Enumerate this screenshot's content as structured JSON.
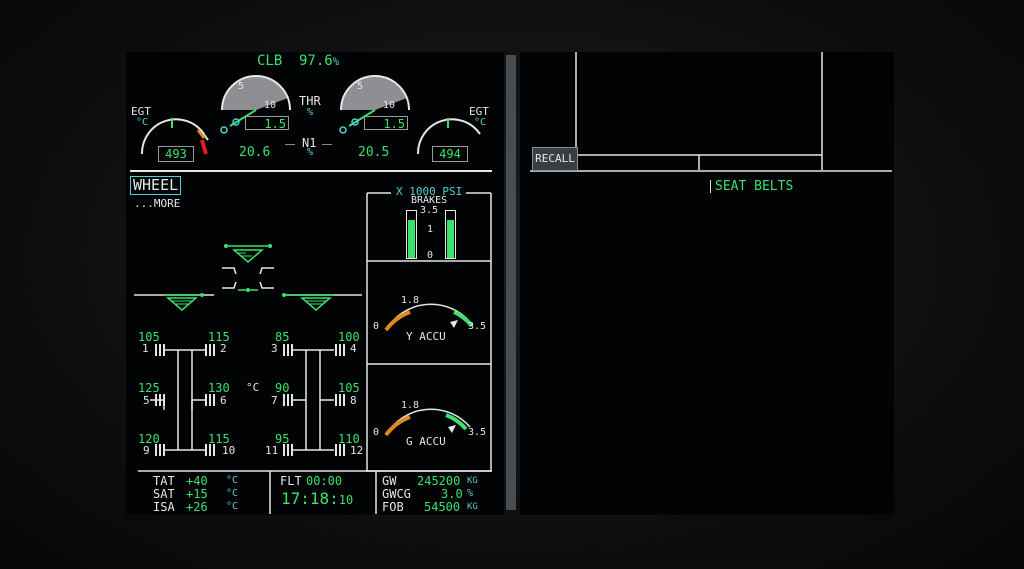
{
  "engine": {
    "mode": "CLB",
    "limit": "97.6",
    "limit_unit": "%",
    "egt_label": "EGT",
    "egt_unit": "°C",
    "egt1": "493",
    "egt2": "494",
    "thr_label": "THR",
    "thr_unit": "%",
    "n1_label": "N1",
    "n1_unit": "%",
    "n1_1": "20.6",
    "n1_2": "20.5",
    "thr1": "1.5",
    "thr2": "1.5",
    "scale_5": "5",
    "scale_10": "10"
  },
  "wheel_page": {
    "title": "WHEEL",
    "more": "...MORE",
    "brakes_header": "X 1000 PSI",
    "brakes_label": "BRAKES",
    "brakes_scale": [
      "3.5",
      "1",
      "0"
    ],
    "temp_unit": "°C",
    "wheels": [
      {
        "num": "1",
        "temp": "105"
      },
      {
        "num": "2",
        "temp": "115"
      },
      {
        "num": "3",
        "temp": "85"
      },
      {
        "num": "4",
        "temp": "100"
      },
      {
        "num": "5",
        "temp": "125"
      },
      {
        "num": "6",
        "temp": "130"
      },
      {
        "num": "7",
        "temp": "90"
      },
      {
        "num": "8",
        "temp": "105"
      },
      {
        "num": "9",
        "temp": "120"
      },
      {
        "num": "10",
        "temp": "115"
      },
      {
        "num": "11",
        "temp": "95"
      },
      {
        "num": "12",
        "temp": "110"
      }
    ],
    "y_accu": {
      "label": "Y ACCU",
      "min": "0",
      "mark": "1.8",
      "max": "3.5"
    },
    "g_accu": {
      "label": "G ACCU",
      "min": "0",
      "mark": "1.8",
      "max": "3.5"
    }
  },
  "footer": {
    "tat_label": "TAT",
    "tat": "+40",
    "sat_label": "SAT",
    "sat": "+15",
    "isa_label": "ISA",
    "isa": "+26",
    "deg_c": "°C",
    "flt_label": "FLT",
    "flt": "00:00",
    "clock_hm": "17:18:",
    "clock_s": "10",
    "gw_label": "GW",
    "gw": "245200",
    "gw_unit": "KG",
    "gwcg_label": "GWCG",
    "gwcg": "3.0",
    "gwcg_unit": "%",
    "fob_label": "FOB",
    "fob": "54500",
    "fob_unit": "KG"
  },
  "memo": {
    "recall": "RECALL",
    "seat_belts": "SEAT BELTS"
  },
  "colors": {
    "green": "#39e36b",
    "cyan": "#4fd0d3",
    "white": "#e6e6e6",
    "amber": "#e08a1e",
    "red": "#e02020"
  }
}
